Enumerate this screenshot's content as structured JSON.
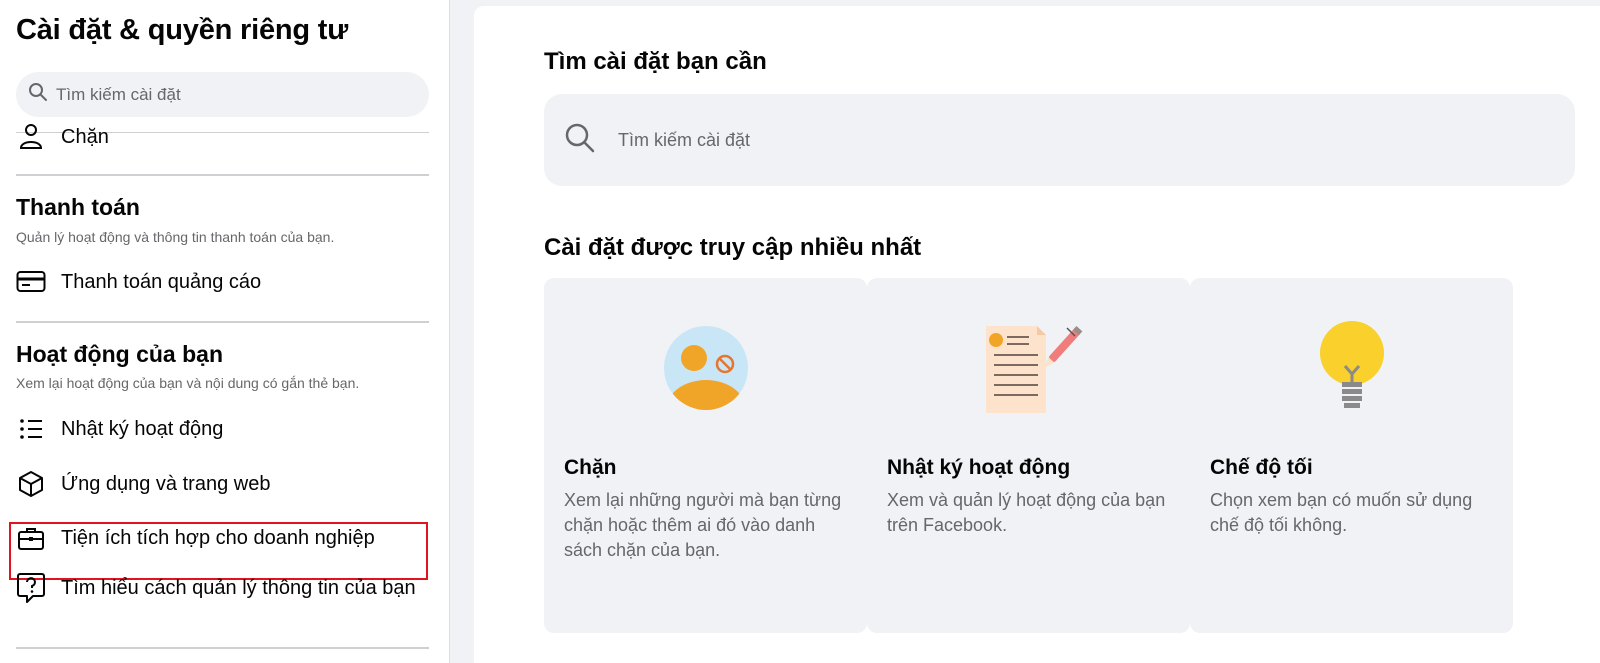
{
  "sidebar": {
    "title": "Cài đặt & quyền riêng tư",
    "search_placeholder": "Tìm kiếm cài đặt",
    "partial_item": "Chặn",
    "payments": {
      "title": "Thanh toán",
      "desc": "Quản lý hoạt động và thông tin thanh toán của bạn.",
      "items": [
        {
          "label": "Thanh toán quảng cáo",
          "icon": "credit-card-icon"
        }
      ]
    },
    "activity": {
      "title": "Hoạt động của bạn",
      "desc": "Xem lại hoạt động của bạn và nội dung có gắn thẻ bạn.",
      "items": [
        {
          "label": "Nhật ký hoạt động",
          "icon": "list-icon"
        },
        {
          "label": "Ứng dụng và trang web",
          "icon": "cube-icon"
        },
        {
          "label": "Tiện ích tích hợp cho doanh nghiệp",
          "icon": "briefcase-icon"
        },
        {
          "label": "Tìm hiểu cách quản lý thông tin của bạn",
          "icon": "question-bubble-icon"
        }
      ]
    }
  },
  "main": {
    "title": "Tìm cài đặt bạn cần",
    "search_placeholder": "Tìm kiếm cài đặt",
    "most_used_title": "Cài đặt được truy cập nhiều nhất",
    "cards": [
      {
        "title": "Chặn",
        "desc": "Xem lại những người mà bạn từng chặn hoặc thêm ai đó vào danh sách chặn của bạn.",
        "icon": "blocked-person-icon"
      },
      {
        "title": "Nhật ký hoạt động",
        "desc": "Xem và quản lý hoạt động của bạn trên Facebook.",
        "icon": "document-pencil-icon"
      },
      {
        "title": "Chế độ tối",
        "desc": "Chọn xem bạn có muốn sử dụng chế độ tối không.",
        "icon": "lightbulb-icon"
      }
    ]
  },
  "colors": {
    "highlight_border": "#e0141e",
    "card_bg": "#f0f2f5",
    "secondary_text": "#65676b"
  }
}
